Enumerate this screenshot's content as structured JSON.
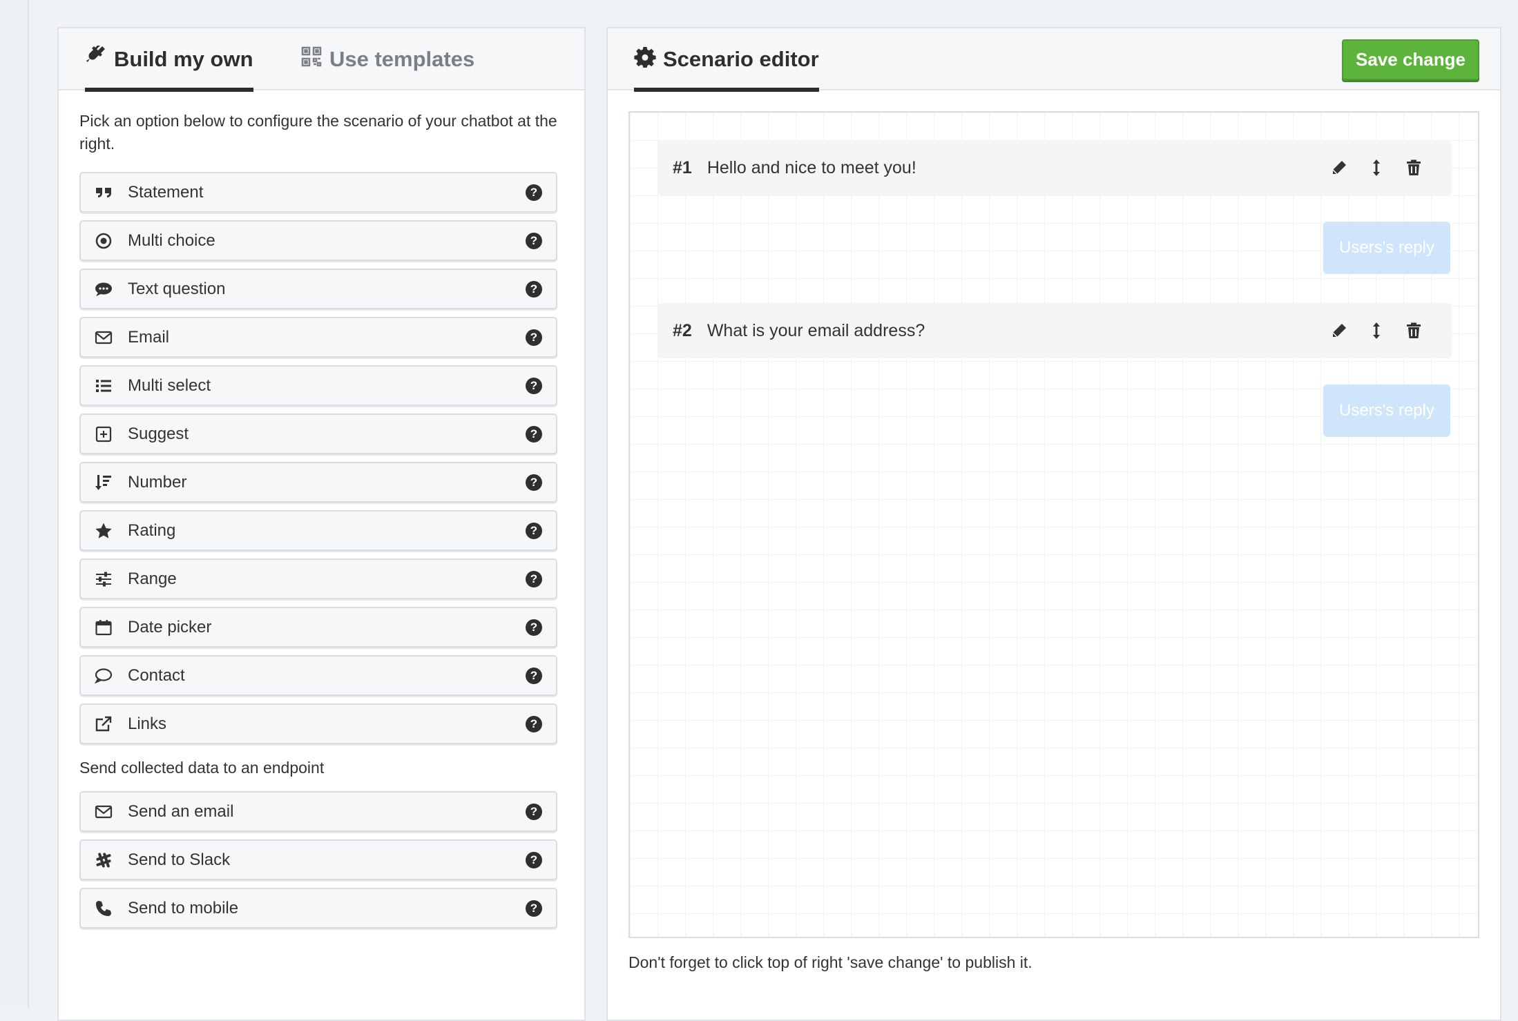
{
  "left_panel": {
    "tabs": [
      {
        "label": "Build my own",
        "icon": "plug-icon",
        "active": true
      },
      {
        "label": "Use templates",
        "icon": "qrcode-icon",
        "active": false
      }
    ],
    "intro": "Pick an option below to configure the scenario of your chatbot at the right.",
    "options": [
      {
        "label": "Statement",
        "icon": "quote-icon"
      },
      {
        "label": "Multi choice",
        "icon": "radio-icon"
      },
      {
        "label": "Text question",
        "icon": "comment-icon"
      },
      {
        "label": "Email",
        "icon": "envelope-icon"
      },
      {
        "label": "Multi select",
        "icon": "list-icon"
      },
      {
        "label": "Suggest",
        "icon": "plus-square-icon"
      },
      {
        "label": "Number",
        "icon": "sort-number-icon"
      },
      {
        "label": "Rating",
        "icon": "star-icon"
      },
      {
        "label": "Range",
        "icon": "sliders-icon"
      },
      {
        "label": "Date picker",
        "icon": "calendar-icon"
      },
      {
        "label": "Contact",
        "icon": "speech-bubble-icon"
      },
      {
        "label": "Links",
        "icon": "external-link-icon"
      }
    ],
    "endpoint_label": "Send collected data to an endpoint",
    "endpoints": [
      {
        "label": "Send an email",
        "icon": "envelope-icon"
      },
      {
        "label": "Send to Slack",
        "icon": "slack-icon"
      },
      {
        "label": "Send to mobile",
        "icon": "phone-icon"
      }
    ],
    "help_glyph": "?"
  },
  "right_panel": {
    "tab": {
      "label": "Scenario editor",
      "icon": "gear-icon"
    },
    "save_button": "Save change",
    "messages": [
      {
        "number": "#1",
        "text": "Hello and nice to meet you!"
      },
      {
        "number": "#2",
        "text": "What is your email address?"
      }
    ],
    "reply_label": "Users's reply",
    "note": "Don't forget to click top of right 'save change' to publish it."
  }
}
